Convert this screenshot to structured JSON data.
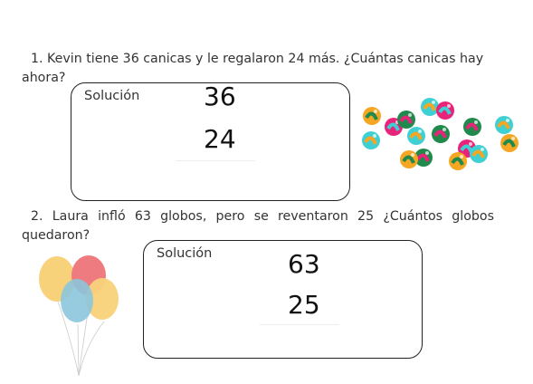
{
  "problems": [
    {
      "question": "1.  Kevin tiene 36 canicas y le regalaron 24 más. ¿Cuántas canicas hay ahora?",
      "solution_label": "Solución",
      "numbers": [
        "36",
        "24"
      ],
      "illustration": "marbles"
    },
    {
      "question": "2. Laura infló 63 globos, pero se reventaron 25 ¿Cuántos globos quedaron?",
      "solution_label": "Solución",
      "numbers": [
        "63",
        "25"
      ],
      "illustration": "balloons"
    }
  ],
  "colors": {
    "marble_orange": "#f5a623",
    "marble_teal": "#3fd0d4",
    "marble_pink": "#e8247a",
    "marble_green": "#1f8a4c",
    "balloon_yellow": "#f8d27a",
    "balloon_red": "#ee7b80",
    "balloon_blue": "#8cc5dc"
  }
}
